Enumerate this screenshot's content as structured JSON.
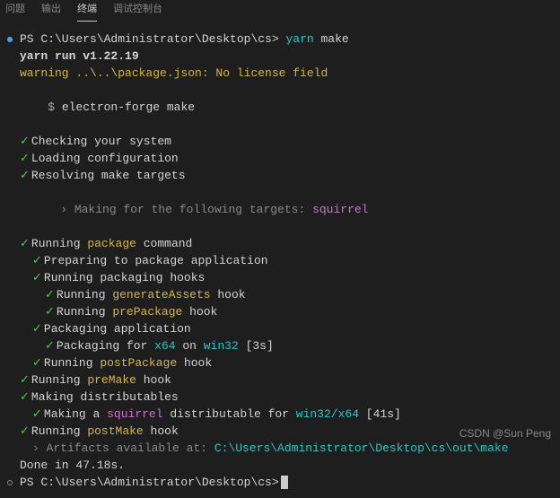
{
  "tabs": {
    "t0": "问题",
    "t1": "输出",
    "t2": "终端",
    "t3": "调试控制台"
  },
  "prompt_prefix": "PS ",
  "cwd": "C:\\Users\\Administrator\\Desktop\\cs>",
  "cmd_prefix": "yarn",
  "cmd_suffix": " make",
  "run_line": "yarn run v1.22.19",
  "warning": "warning ..\\..\\package.json: No license field",
  "forge_prefix": "$ ",
  "forge_cmd": "electron-forge make",
  "steps": {
    "checking": "Checking your system",
    "loading": "Loading configuration",
    "resolving": "Resolving make targets",
    "targets_prefix": "› Making for the following targets: ",
    "targets_value": "squirrel",
    "running_pkg_prefix": "Running ",
    "running_pkg_cmd": "package",
    "running_pkg_suffix": " command",
    "preparing": "Preparing to package application",
    "hooks": "Running packaging hooks",
    "gen_assets_prefix": "Running ",
    "gen_assets_cmd": "generateAssets",
    "gen_assets_suffix": " hook",
    "prepkg_prefix": "Running ",
    "prepkg_cmd": "prePackage",
    "prepkg_suffix": " hook",
    "packaging": "Packaging application",
    "pkg_for_prefix": "Packaging for ",
    "pkg_for_arch": "x64",
    "pkg_for_on": " on ",
    "pkg_for_os": "win32",
    "pkg_for_time": " [3s]",
    "postpkg_prefix": "Running ",
    "postpkg_cmd": "postPackage",
    "postpkg_suffix": " hook",
    "premake_prefix": "Running ",
    "premake_cmd": "preMake",
    "premake_suffix": " hook",
    "making_dist": "Making distributables",
    "making_a": "Making a ",
    "making_type": "squirrel",
    "making_for": " distributable for ",
    "making_target": "win32/x64",
    "making_time": " [41s]",
    "postmake_prefix": "Running ",
    "postmake_cmd": "postMake",
    "postmake_suffix": " hook",
    "artifacts_prefix": "› Artifacts available at: ",
    "artifacts_path": "C:\\Users\\Administrator\\Desktop\\cs\\out\\make",
    "done": "Done in 47.18s."
  },
  "watermark": "CSDN @Sun Peng"
}
